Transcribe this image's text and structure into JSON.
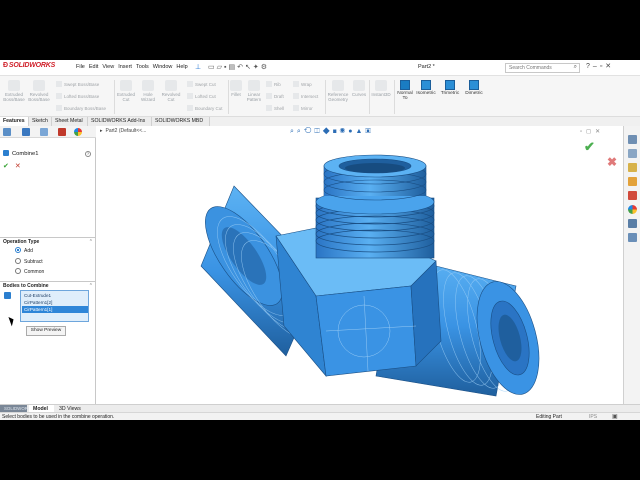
{
  "app": {
    "name": "SOLIDWORKS",
    "document_title": "Part2 *"
  },
  "menu": [
    "File",
    "Edit",
    "View",
    "Insert",
    "Tools",
    "Window",
    "Help"
  ],
  "search": {
    "placeholder": "Search Commands"
  },
  "commands": {
    "extruded_boss": "Extruded Boss/Base",
    "revolved_boss": "Revolved Boss/Base",
    "swept_boss": "Swept Boss/Base",
    "lofted_boss": "Lofted Boss/Base",
    "boundary_boss": "Boundary Boss/Base",
    "extruded_cut": "Extruded Cut",
    "hole_wizard": "Hole Wizard",
    "revolved_cut": "Revolved Cut",
    "swept_cut": "Swept Cut",
    "lofted_cut": "Lofted Cut",
    "boundary_cut": "Boundary Cut",
    "fillet": "Fillet",
    "linear_pattern": "Linear Pattern",
    "rib": "Rib",
    "draft": "Draft",
    "shell": "Shell",
    "wrap": "Wrap",
    "intersect": "Intersect",
    "mirror": "Mirror",
    "reference_geometry": "Reference Geometry",
    "curves": "Curves",
    "instant3d": "Instant3D",
    "normal_to": "Normal To",
    "isometric": "Isometric",
    "trimetric": "Trimetric",
    "dimetric": "Dimetric"
  },
  "tabs": [
    "Features",
    "Sketch",
    "Sheet Metal",
    "SOLIDWORKS Add-Ins",
    "SOLIDWORKS MBD"
  ],
  "property_manager": {
    "title": "Combine1",
    "operation_type_header": "Operation Type",
    "operations": [
      "Add",
      "Subtract",
      "Common"
    ],
    "selected_operation": "Add",
    "bodies_header": "Bodies to Combine",
    "bodies": [
      "Cut-Extrude1",
      "CirPattern1[2]",
      "CirPattern1[1]"
    ],
    "selected_body": "CirPattern1[1]",
    "show_preview": "Show Preview"
  },
  "graphics": {
    "tree_label": "Part2  (Default<<..."
  },
  "bottom_tabs": {
    "tag": "SOLIDWORKS",
    "model": "Model",
    "views": "3D Views"
  },
  "status": {
    "message": "Select bodies to be used in the combine operation.",
    "mode": "Editing Part",
    "units": "IPS"
  },
  "colors": {
    "model_blue": "#3a93e4",
    "model_dark": "#1f5f9e",
    "accent_red": "#d0202a",
    "ok_green": "#35a232"
  }
}
